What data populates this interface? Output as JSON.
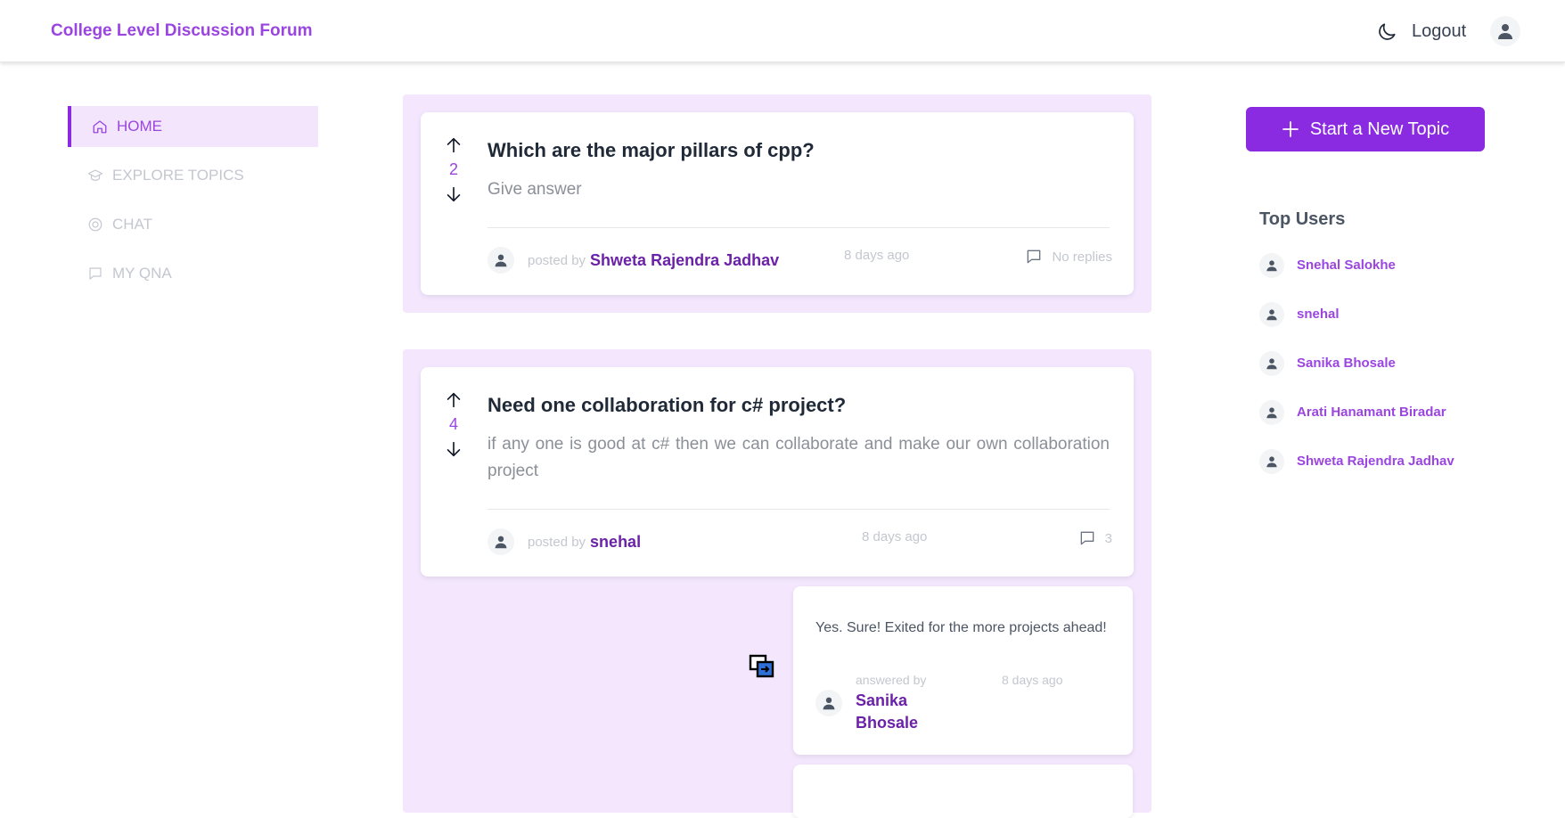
{
  "header": {
    "brand": "College Level Discussion Forum",
    "logout_label": "Logout",
    "theme_icon": "moon-icon",
    "avatar_icon": "user-icon"
  },
  "sidebar": {
    "items": [
      {
        "label": "HOME",
        "icon": "home-icon",
        "active": true
      },
      {
        "label": "EXPLORE TOPICS",
        "icon": "graduation-cap-icon",
        "active": false
      },
      {
        "label": "CHAT",
        "icon": "target-icon",
        "active": false
      },
      {
        "label": "MY QNA",
        "icon": "comment-icon",
        "active": false
      }
    ]
  },
  "posts": [
    {
      "votes": "2",
      "title": "Which are the major pillars of cpp?",
      "body": "Give answer",
      "posted_by_label": "posted by",
      "author": "Shweta Rajendra Jadhav",
      "time": "8 days ago",
      "replies": "No replies"
    },
    {
      "votes": "4",
      "title": "Need one collaboration for c# project?",
      "body": "if any one is good at c# then we can collaborate and make our own collaboration project",
      "posted_by_label": "posted by",
      "author": "snehal",
      "time": "8 days ago",
      "replies": "3",
      "answers": [
        {
          "text": "Yes. Sure! Exited for the more projects ahead!",
          "answered_by_label": "answered by",
          "author": "Sanika Bhosale",
          "time": "8 days ago"
        }
      ]
    }
  ],
  "right": {
    "new_topic_label": "Start a New Topic",
    "top_users_title": "Top Users",
    "top_users": [
      "Snehal Salokhe",
      "snehal",
      "Sanika Bhosale",
      "Arati Hanamant Biradar",
      "Shweta Rajendra Jadhav"
    ]
  },
  "colors": {
    "accent": "#8a2be2",
    "accent_text": "#9b45e0",
    "panel_bg": "#f3e6fd",
    "author_text": "#6b21a8"
  }
}
